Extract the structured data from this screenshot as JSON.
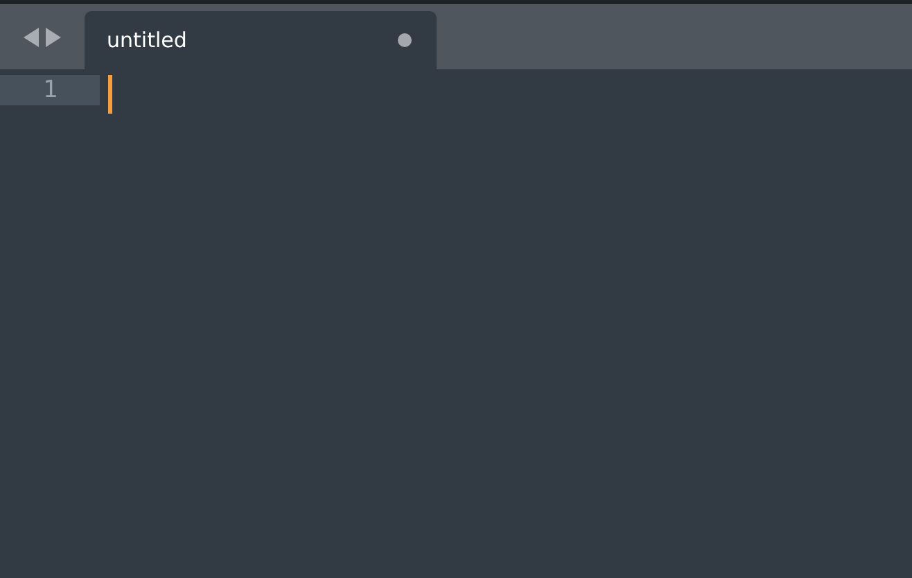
{
  "tabs": [
    {
      "label": "untitled",
      "selected": true,
      "modified": true
    }
  ],
  "lines": [
    {
      "number": "1",
      "current": true
    }
  ]
}
